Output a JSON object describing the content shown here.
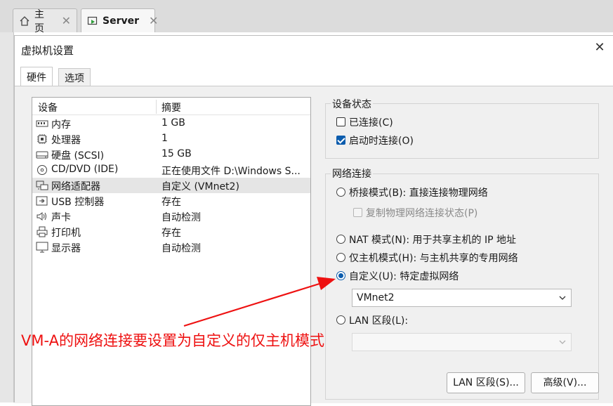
{
  "app_tabs": [
    {
      "label": "主页",
      "icon": "home-icon"
    },
    {
      "label": "Server",
      "icon": "vm-icon"
    }
  ],
  "dialog": {
    "title": "虚拟机设置",
    "tabs": [
      {
        "label": "硬件"
      },
      {
        "label": "选项"
      }
    ]
  },
  "device_list": {
    "headers": {
      "device": "设备",
      "summary": "摘要"
    },
    "rows": [
      {
        "name": "内存",
        "summary": "1 GB",
        "icon": "memory-icon"
      },
      {
        "name": "处理器",
        "summary": "1",
        "icon": "cpu-icon"
      },
      {
        "name": "硬盘 (SCSI)",
        "summary": "15 GB",
        "icon": "disk-icon"
      },
      {
        "name": "CD/DVD (IDE)",
        "summary": "正在使用文件 D:\\Windows S...",
        "icon": "cd-icon"
      },
      {
        "name": "网络适配器",
        "summary": "自定义 (VMnet2)",
        "icon": "network-icon"
      },
      {
        "name": "USB 控制器",
        "summary": "存在",
        "icon": "usb-icon"
      },
      {
        "name": "声卡",
        "summary": "自动检测",
        "icon": "sound-icon"
      },
      {
        "name": "打印机",
        "summary": "存在",
        "icon": "printer-icon"
      },
      {
        "name": "显示器",
        "summary": "自动检测",
        "icon": "monitor-icon"
      }
    ]
  },
  "device_status": {
    "title": "设备状态",
    "connected": "已连接(C)",
    "connect_at_power_on": "启动时连接(O)"
  },
  "network_connection": {
    "title": "网络连接",
    "bridged": "桥接模式(B): 直接连接物理网络",
    "replicate": "复制物理网络连接状态(P)",
    "nat": "NAT 模式(N): 用于共享主机的 IP 地址",
    "host_only": "仅主机模式(H): 与主机共享的专用网络",
    "custom": "自定义(U): 特定虚拟网络",
    "custom_value": "VMnet2",
    "lan_segment": "LAN 区段(L):",
    "lan_value": ""
  },
  "buttons": {
    "lan_segments": "LAN 区段(S)...",
    "advanced": "高级(V)..."
  },
  "annotation": {
    "text": "VM-A的网络连接要设置为自定义的仅主机模式",
    "color": "#ee1111"
  }
}
